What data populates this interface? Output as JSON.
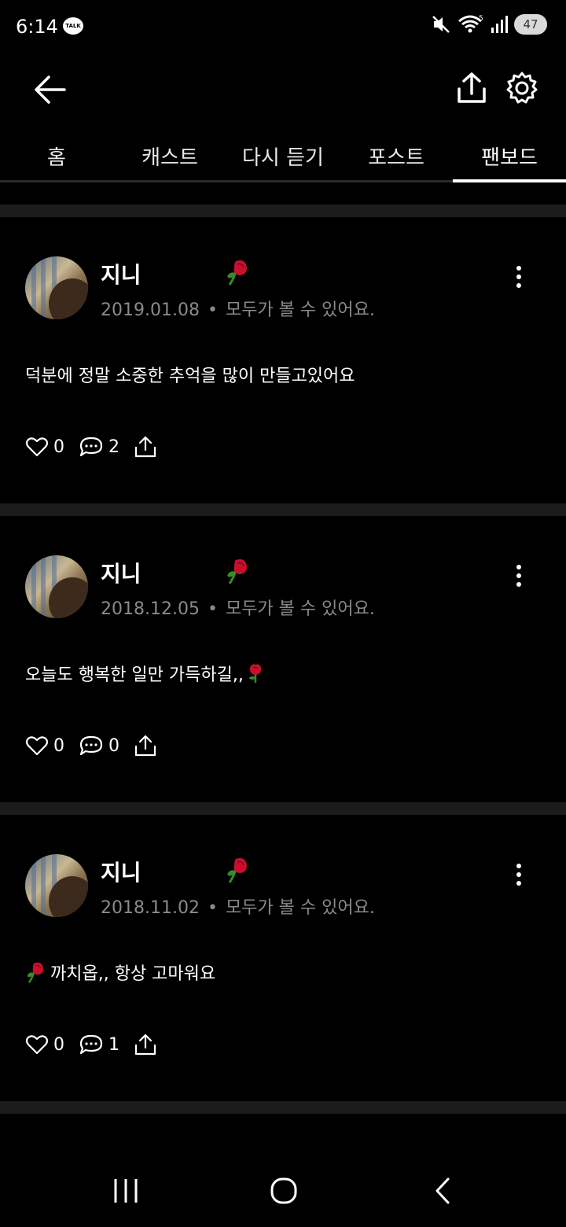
{
  "status_bar": {
    "time": "6:14",
    "notification_badge": "TALK",
    "battery": "47",
    "wifi_label": "5"
  },
  "header": {
    "back_icon": "arrow-left-icon",
    "share_icon": "share-icon",
    "settings_icon": "gear-icon"
  },
  "tabs": [
    {
      "label": "홈",
      "active": false
    },
    {
      "label": "캐스트",
      "active": false
    },
    {
      "label": "다시 듣기",
      "active": false
    },
    {
      "label": "포스트",
      "active": false
    },
    {
      "label": "팬보드",
      "active": true
    }
  ],
  "posts": [
    {
      "author": "지니",
      "date": "2019.01.08",
      "visibility": "모두가 볼 수 있어요.",
      "text": "덕분에 정말 소중한 추억을 많이 만들고있어요",
      "text_emoji_position": "none",
      "likes": "0",
      "comments": "2"
    },
    {
      "author": "지니",
      "date": "2018.12.05",
      "visibility": "모두가 볼 수 있어요.",
      "text": "오늘도 행복한 일만 가득하길,,",
      "text_emoji_position": "after",
      "likes": "0",
      "comments": "0"
    },
    {
      "author": "지니",
      "date": "2018.11.02",
      "visibility": "모두가 볼 수 있어요.",
      "text": "까치옵,, 항상 고마워요",
      "text_emoji_position": "before",
      "likes": "0",
      "comments": "1"
    }
  ],
  "colors": {
    "background": "#000000",
    "separator": "#1c1c1c",
    "meta_text": "#8a8a8a",
    "rose": "#c8102e"
  }
}
